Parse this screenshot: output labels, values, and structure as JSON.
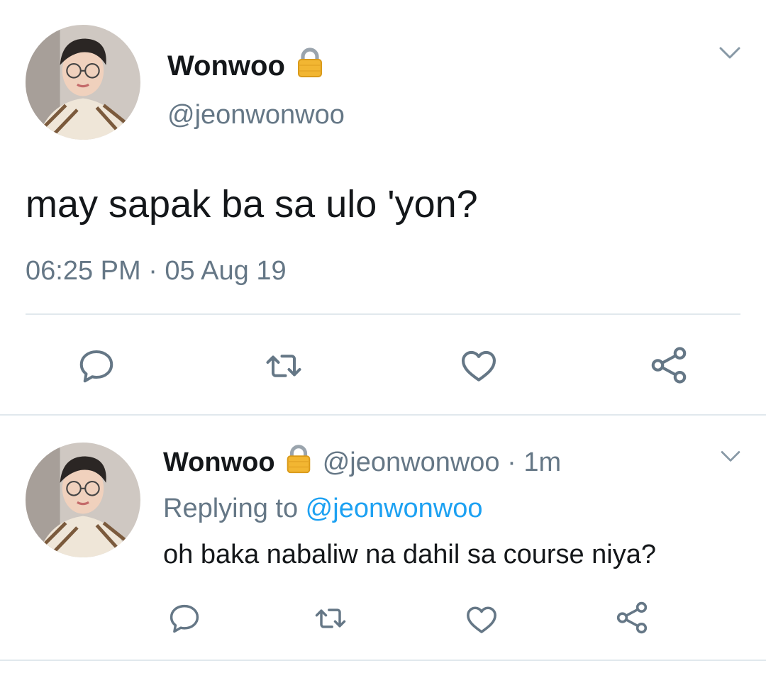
{
  "main_tweet": {
    "display_name": "Wonwoo",
    "handle": "@jeonwonwoo",
    "text": "may sapak ba sa ulo 'yon?",
    "timestamp": "06:25 PM · 05 Aug 19",
    "icons": [
      "avatar",
      "lock-icon",
      "chevron-down-icon",
      "reply-icon",
      "retweet-icon",
      "like-icon",
      "share-icon"
    ]
  },
  "reply_tweet": {
    "display_name": "Wonwoo",
    "handle": "@jeonwonwoo",
    "time_sep": " · 1m",
    "replying_label": "Replying to ",
    "replying_handle": "@jeonwonwoo",
    "text": "oh baka nabaliw na dahil sa course niya?"
  },
  "colors": {
    "text": "#14171a",
    "muted": "#657786",
    "link": "#1da1f2",
    "divider": "#e1e8ed",
    "lock": "#f2b632"
  }
}
